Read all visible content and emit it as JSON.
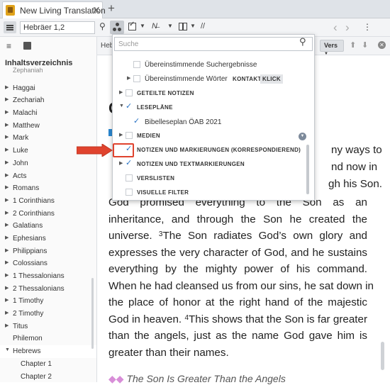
{
  "tabs": [
    {
      "title": "New Living Translation",
      "close": "✕"
    }
  ],
  "toolbar": {
    "reference": "Hebräer 1,2",
    "search_icon": "⚲",
    "add_tab": "+",
    "slashes": "//",
    "back": "‹",
    "forward": "›"
  },
  "sidebar": {
    "title": "Inhaltsverzeichnis",
    "items": [
      {
        "label": "Zephaniah",
        "partial": true
      },
      {
        "label": "Haggai"
      },
      {
        "label": "Zechariah"
      },
      {
        "label": "Malachi"
      },
      {
        "label": "Matthew"
      },
      {
        "label": "Mark"
      },
      {
        "label": "Luke"
      },
      {
        "label": "John"
      },
      {
        "label": "Acts"
      },
      {
        "label": "Romans"
      },
      {
        "label": "1 Corinthians"
      },
      {
        "label": "2 Corinthians"
      },
      {
        "label": "Galatians"
      },
      {
        "label": "Ephesians"
      },
      {
        "label": "Philippians"
      },
      {
        "label": "Colossians"
      },
      {
        "label": "1 Thessalonians"
      },
      {
        "label": "2 Thessalonians"
      },
      {
        "label": "1 Timothy"
      },
      {
        "label": "2 Timothy"
      },
      {
        "label": "Titus"
      },
      {
        "label": "Philemon",
        "noarrow": true
      },
      {
        "label": "Hebrews",
        "open": true
      },
      {
        "label": "Chapter 1",
        "child": true
      },
      {
        "label": "Chapter 2",
        "child": true
      }
    ]
  },
  "main": {
    "ref_label": "Heb",
    "vers_label": "Vers",
    "big_letter": "C",
    "peek_lines": [
      "ny ways to",
      "nd now in",
      "gh his Son."
    ],
    "lines": [
      {
        "text": "God promised everything to the Son as an"
      },
      {
        "text": "inheritance, and through the Son he created the"
      },
      {
        "pre": "universe. ",
        "vn": "3",
        "text": "The Son radiates God’s own glory and"
      },
      {
        "text": "expresses the very character of God, and he sustains"
      },
      {
        "text": "everything by the mighty power of his command."
      },
      {
        "text": "When he had cleansed us from our sins, he sat down in"
      },
      {
        "text": "the place of honor at the right hand of the majestic"
      },
      {
        "pre": "God in heaven. ",
        "vn": "4",
        "text": "This shows that the Son is far greater"
      },
      {
        "text": "than the angels, just as the name God gave him is"
      },
      {
        "text": "greater than their names.",
        "last": true
      }
    ],
    "heading_dots": "◆◆",
    "heading": "The Son Is Greater Than the Angels"
  },
  "dropdown": {
    "search_placeholder": "Suche",
    "rows": [
      {
        "label": "Übereinstimmende Suchergebnisse",
        "caps": false,
        "checked": false,
        "indent": 2,
        "expander": false
      },
      {
        "label": "Übereinstimmende Wörter",
        "caps": false,
        "checked": false,
        "indent": 2,
        "expander": true,
        "tags": [
          "KONTAKT",
          "KLICK"
        ]
      },
      {
        "label": "GETEILTE NOTIZEN",
        "caps": true,
        "checked": false,
        "indent": 1,
        "expander": true
      },
      {
        "label": "LESEPLÄNE",
        "caps": true,
        "checked": true,
        "indent": 1,
        "expander": true,
        "expanded": true
      },
      {
        "label": "Bibelleseplan ÖAB 2021",
        "caps": false,
        "checked": true,
        "indent": 2,
        "expander": false
      },
      {
        "label": "MEDIEN",
        "caps": true,
        "checked": false,
        "indent": 1,
        "expander": true
      },
      {
        "label": "NOTIZEN UND MARKIERUNGEN (KORRESPONDIEREND)",
        "caps": true,
        "checked": true,
        "indent": 1,
        "expander": false
      },
      {
        "label": "NOTIZEN UND TEXTMARKIERUNGEN",
        "caps": true,
        "checked": true,
        "indent": 1,
        "expander": true
      },
      {
        "label": "VERSLISTEN",
        "caps": true,
        "checked": false,
        "indent": 1,
        "expander": false
      },
      {
        "label": "VISUELLE FILTER",
        "caps": true,
        "checked": false,
        "indent": 1,
        "expander": false
      }
    ]
  },
  "colors": {
    "accent_blue": "#2a74c5",
    "callout_red": "#e0432e",
    "app_icon": "#e0a21a"
  }
}
